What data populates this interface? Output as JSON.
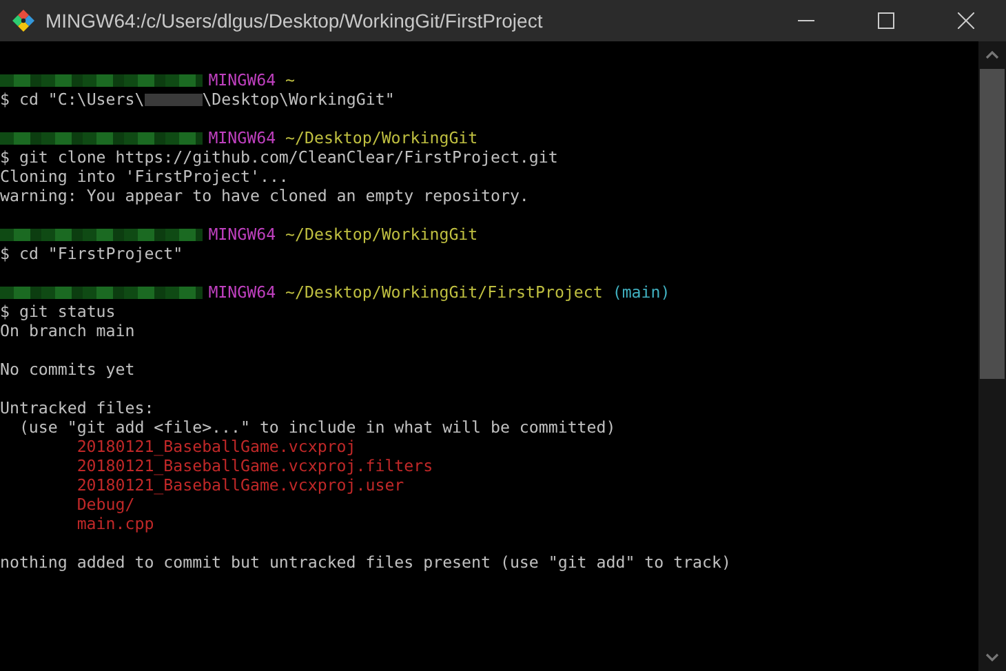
{
  "window": {
    "title": "MINGW64:/c/Users/dlgus/Desktop/WorkingGit/FirstProject"
  },
  "terminal": {
    "lines": [
      {
        "kind": "prompt",
        "system": "MINGW64",
        "path": "~"
      },
      {
        "kind": "command",
        "segments": [
          {
            "kind": "text",
            "text": "$ cd \"C:\\Users\\"
          },
          {
            "kind": "redacted"
          },
          {
            "kind": "text",
            "text": "\\Desktop\\WorkingGit\""
          }
        ]
      },
      {
        "kind": "blank"
      },
      {
        "kind": "prompt",
        "system": "MINGW64",
        "path": "~/Desktop/WorkingGit"
      },
      {
        "kind": "command",
        "segments": [
          {
            "kind": "text",
            "text": "$ git clone https://github.com/CleanClear/FirstProject.git"
          }
        ]
      },
      {
        "kind": "output",
        "text": "Cloning into 'FirstProject'..."
      },
      {
        "kind": "output",
        "text": "warning: You appear to have cloned an empty repository."
      },
      {
        "kind": "blank"
      },
      {
        "kind": "prompt",
        "system": "MINGW64",
        "path": "~/Desktop/WorkingGit"
      },
      {
        "kind": "command",
        "segments": [
          {
            "kind": "text",
            "text": "$ cd \"FirstProject\""
          }
        ]
      },
      {
        "kind": "blank"
      },
      {
        "kind": "prompt",
        "system": "MINGW64",
        "path": "~/Desktop/WorkingGit/FirstProject",
        "branch": "(main)"
      },
      {
        "kind": "command",
        "segments": [
          {
            "kind": "text",
            "text": "$ git status"
          }
        ]
      },
      {
        "kind": "output",
        "text": "On branch main"
      },
      {
        "kind": "blank"
      },
      {
        "kind": "output",
        "text": "No commits yet"
      },
      {
        "kind": "blank"
      },
      {
        "kind": "output",
        "text": "Untracked files:"
      },
      {
        "kind": "hint",
        "text": "(use \"git add <file>...\" to include in what will be committed)"
      },
      {
        "kind": "file",
        "text": "20180121_BaseballGame.vcxproj"
      },
      {
        "kind": "file",
        "text": "20180121_BaseballGame.vcxproj.filters"
      },
      {
        "kind": "file",
        "text": "20180121_BaseballGame.vcxproj.user"
      },
      {
        "kind": "file",
        "text": "Debug/"
      },
      {
        "kind": "file",
        "text": "main.cpp"
      },
      {
        "kind": "blank"
      },
      {
        "kind": "output",
        "text": "nothing added to commit but untracked files present (use \"git add\" to track)"
      }
    ]
  }
}
